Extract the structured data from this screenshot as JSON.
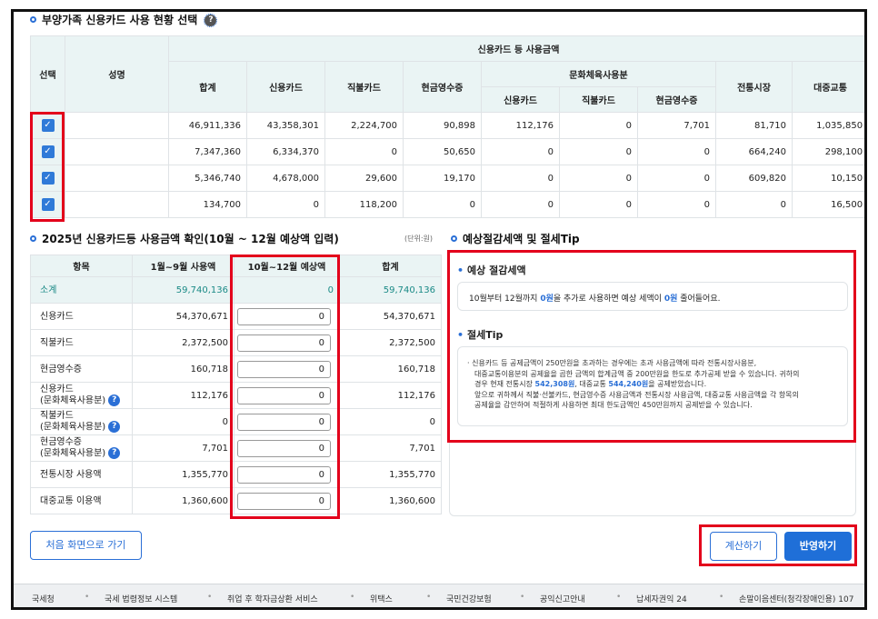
{
  "section1": {
    "title": "부양가족 신용카드 사용 현황 선택"
  },
  "table1": {
    "col_check": "선택",
    "col_name": "성명",
    "group_all": "신용카드 등 사용금액",
    "col_total": "합계",
    "col_credit": "신용카드",
    "col_debit": "직불카드",
    "col_cash": "현금영수증",
    "group_culture": "문화체육사용분",
    "col_c_credit": "신용카드",
    "col_c_debit": "직불카드",
    "col_c_cash": "현금영수증",
    "col_market": "전통시장",
    "col_transit": "대중교통",
    "rows": [
      {
        "checked": true,
        "values": [
          "46,911,336",
          "43,358,301",
          "2,224,700",
          "90,898",
          "112,176",
          "0",
          "7,701",
          "81,710",
          "1,035,850"
        ]
      },
      {
        "checked": true,
        "values": [
          "7,347,360",
          "6,334,370",
          "0",
          "50,650",
          "0",
          "0",
          "0",
          "664,240",
          "298,100"
        ]
      },
      {
        "checked": true,
        "values": [
          "5,346,740",
          "4,678,000",
          "29,600",
          "19,170",
          "0",
          "0",
          "0",
          "609,820",
          "10,150"
        ]
      },
      {
        "checked": true,
        "values": [
          "134,700",
          "0",
          "118,200",
          "0",
          "0",
          "0",
          "0",
          "0",
          "16,500"
        ]
      }
    ]
  },
  "section2": {
    "title": "2025년 신용카드등 사용금액 확인(10월 ~ 12월 예상액 입력)",
    "unit": "(단위:원)"
  },
  "table2": {
    "col_item": "항목",
    "col_jan_sep": "1월~9월 사용액",
    "col_oct_dec": "10월~12월 예상액",
    "col_sum": "합계",
    "subtotal": {
      "label": "소계",
      "jan_sep": "59,740,136",
      "oct_dec": "0",
      "sum": "59,740,136"
    },
    "rows": [
      {
        "label": "신용카드",
        "jan_sep": "54,370,671",
        "input": "0",
        "sum": "54,370,671"
      },
      {
        "label": "직불카드",
        "jan_sep": "2,372,500",
        "input": "0",
        "sum": "2,372,500"
      },
      {
        "label": "현금영수증",
        "jan_sep": "160,718",
        "input": "0",
        "sum": "160,718"
      },
      {
        "label": "신용카드",
        "label2": "(문화체육사용분)",
        "jan_sep": "112,176",
        "input": "0",
        "sum": "112,176"
      },
      {
        "label": "직불카드",
        "label2": "(문화체육사용분)",
        "jan_sep": "0",
        "input": "0",
        "sum": "0"
      },
      {
        "label": "현금영수증",
        "label2": "(문화체육사용분)",
        "jan_sep": "7,701",
        "input": "0",
        "sum": "7,701"
      },
      {
        "label": "전통시장 사용액",
        "jan_sep": "1,355,770",
        "input": "0",
        "sum": "1,355,770"
      },
      {
        "label": "대중교통 이용액",
        "jan_sep": "1,360,600",
        "input": "0",
        "sum": "1,360,600"
      }
    ]
  },
  "section3": {
    "title": "예상절감세액 및 절세Tip"
  },
  "expected": {
    "title": "예상 절감세액",
    "text_pre": "10월부터 12월까지 ",
    "amount1": "0원",
    "text_mid": "을 추가로 사용하면 예상 세액이 ",
    "amount2": "0원",
    "text_post": " 줄어들어요."
  },
  "tip": {
    "title": "절세Tip",
    "line1": "신용카드 등 공제금액이 250만원을 초과하는 경우에는 초과 사용금액에 따라 전통시장사용분,",
    "line2": "대중교통이용분의 공제율을 곱한 금액의 합계금액 중 200만원을 한도로 추가공제 받을 수 있습니다. 귀하의",
    "line3_pre": "경우 현재 전통시장 ",
    "market_amount": "542,308원",
    "line3_mid": ", 대중교통 ",
    "transit_amount": "544,240원",
    "line3_post": "을 공제받았습니다.",
    "line4": "앞으로 귀하께서 직불·선불카드, 현금영수증 사용금액과 전통시장 사용금액, 대중교통 사용금액을 각 항목의",
    "line5": "공제율을 감안하여 적절하게 사용하면 최대 한도금액인 450만원까지 공제받을 수 있습니다."
  },
  "buttons": {
    "home": "처음 화면으로 가기",
    "calculate": "계산하기",
    "apply": "반영하기"
  },
  "footer": {
    "links": [
      "국세청",
      "국세 법령정보 시스템",
      "취업 후 학자금상환 서비스",
      "위택스",
      "국민건강보험",
      "공익신고안내",
      "납세자권익 24",
      "손말이음센터(청각장애인용) 107"
    ]
  },
  "colors": {
    "accent": "#2a6fd6",
    "highlight": "#e3001b",
    "header_bg": "#eaf4f4",
    "subtotal_text": "#1a8a86"
  }
}
